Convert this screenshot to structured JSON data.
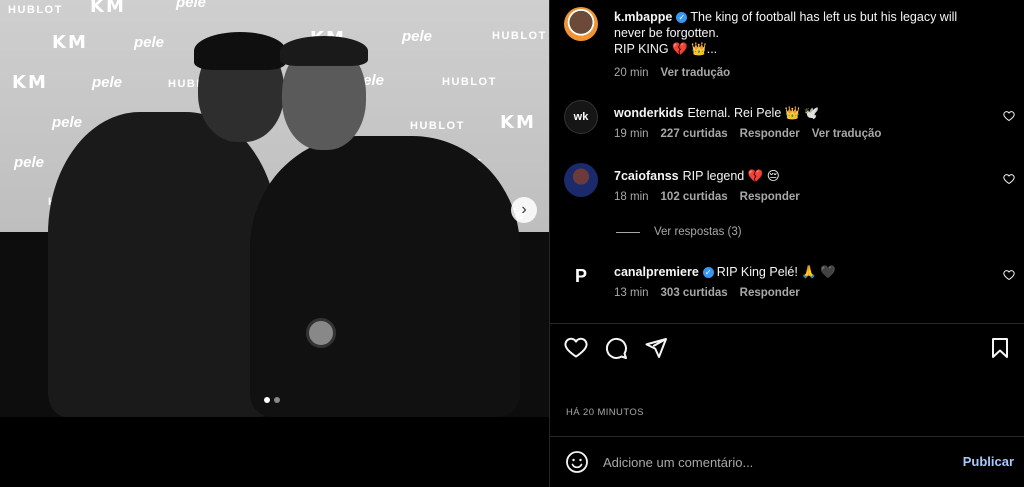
{
  "media": {
    "brands": [
      "HUBLOT",
      "pele",
      "KM"
    ],
    "carousel": {
      "total": 2,
      "active": 1
    }
  },
  "post": {
    "username": "k.mbappe",
    "verified": true,
    "caption": "The king of football has left us but his legacy will never be forgotten.",
    "caption_line2": "RIP KING 💔 👑...",
    "time": "20 min",
    "translate": "Ver tradução"
  },
  "comments": [
    {
      "username": "wonderkids",
      "avatar_text": "wk",
      "text": "Eternal. Rei Pele 👑 🕊️",
      "time": "19 min",
      "likes": "227 curtidas",
      "reply": "Responder",
      "translate": "Ver tradução"
    },
    {
      "username": "7caiofanss",
      "text": "RIP legend 💔 😔",
      "time": "18 min",
      "likes": "102 curtidas",
      "reply": "Responder",
      "view_replies": "Ver respostas (3)"
    },
    {
      "username": "canalpremiere",
      "verified": true,
      "avatar_text": "P",
      "text": "RIP King Pelé! 🙏 🖤",
      "time": "13 min",
      "likes": "303 curtidas",
      "reply": "Responder"
    }
  ],
  "actions": {
    "like": "heart-icon",
    "comment": "comment-icon",
    "share": "send-icon",
    "save": "bookmark-icon"
  },
  "timestamp": "HÁ 20 MINUTOS",
  "add_comment": {
    "placeholder": "Adicione um comentário...",
    "publish": "Publicar"
  },
  "colors": {
    "background": "#000000",
    "muted": "#a8a8a8",
    "verified": "#3897f0",
    "publish": "#a8c7fa"
  }
}
